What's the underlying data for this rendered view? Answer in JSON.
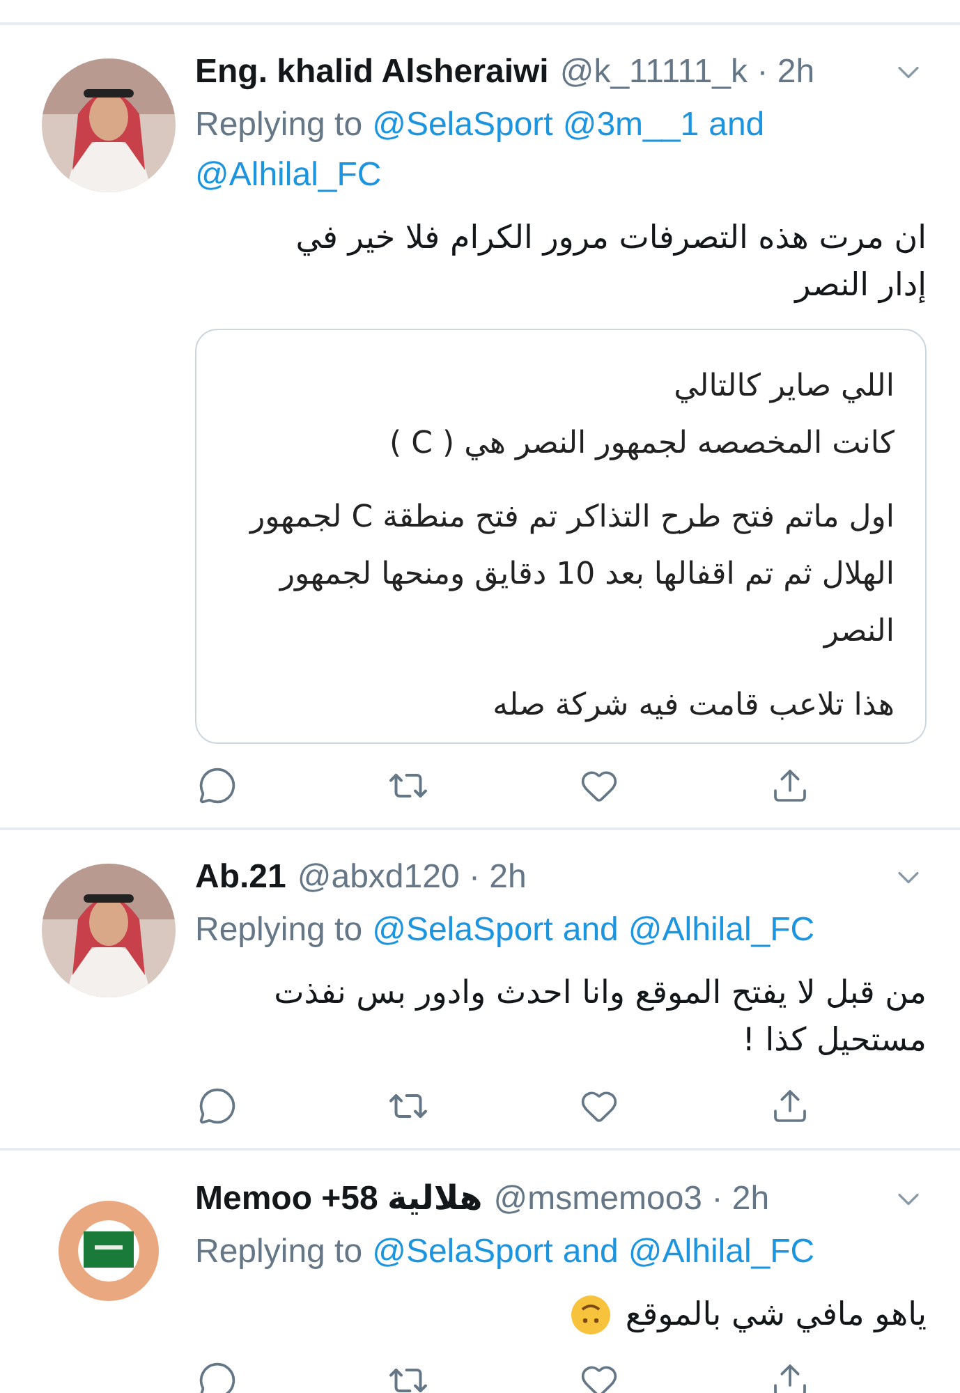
{
  "tweets": [
    {
      "name": "Eng. khalid Alsheraiwi",
      "handle": "@k_11111_k",
      "separator": "·",
      "time": "2h",
      "reply": {
        "prefix": "Replying to",
        "first_mention": "@SelaSport",
        "second_mention": "@3m__1",
        "joiner": "and",
        "last_mention": "@Alhilal_FC"
      },
      "text": "ان مرت هذه التصرفات مرور الكرام فلا خير في إدار النصر",
      "card": {
        "paragraphs": [
          [
            "اللي صاير كالتالي",
            "كانت المخصصه لجمهور النصر هي ( C )"
          ],
          [
            "اول ماتم فتح طرح التذاكر  تم فتح منطقة C لجمهور الهلال ثم تم اقفالها بعد 10 دقايق ومنحها لجمهور النصر"
          ],
          [
            "هذا تلاعب قامت فيه شركة صله"
          ]
        ]
      }
    },
    {
      "name": "Ab.21",
      "handle": "@abxd120",
      "separator": "·",
      "time": "2h",
      "reply": {
        "prefix": "Replying to",
        "first_mention": "@SelaSport",
        "joiner": "and",
        "last_mention": "@Alhilal_FC"
      },
      "text": "من قبل لا يفتح الموقع وانا احدث وادور بس نفذت مستحيل كذا !"
    },
    {
      "name": "Memoo +58 هلالية",
      "handle": "@msmemoo3",
      "separator": "·",
      "time": "2h",
      "reply": {
        "prefix": "Replying to",
        "first_mention": "@SelaSport",
        "joiner": "and",
        "last_mention": "@Alhilal_FC"
      },
      "text": "ياهو مافي شي بالموقع",
      "emoji": true
    }
  ]
}
